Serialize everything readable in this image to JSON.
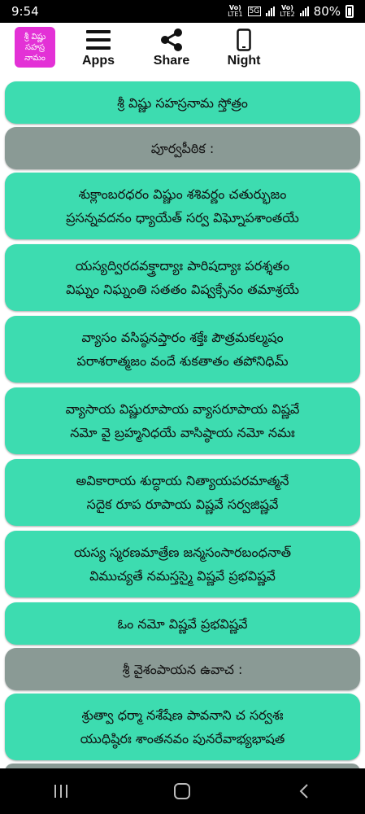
{
  "status": {
    "time": "9:54",
    "sim1_top": "Vo)",
    "sim1_bottom": "LTE1",
    "net_5g": "5G",
    "sim2_top": "Vo)",
    "sim2_bottom": "LTE2",
    "battery": "80%"
  },
  "header": {
    "logo_text": "శ్రీ విష్ణు సహస్ర నామం",
    "nav": [
      {
        "label": "Apps",
        "icon": "menu-icon"
      },
      {
        "label": "Share",
        "icon": "share-icon"
      },
      {
        "label": "Night",
        "icon": "phone-icon"
      }
    ]
  },
  "colors": {
    "verse_bg": "#3ddcb0",
    "heading_bg": "#8a9a95",
    "logo_bg": "#e331d6"
  },
  "items": [
    {
      "type": "verse",
      "lines": [
        "శ్రీ విష్ణు సహస్రనామ స్తోత్రం"
      ]
    },
    {
      "type": "heading",
      "lines": [
        "పూర్వపీఠిక :"
      ]
    },
    {
      "type": "verse",
      "lines": [
        "శుక్లాంబరధరం విష్ణుం శశివర్ణం చతుర్భుజం",
        "ప్రసన్నవదనం ధ్యాయేత్ సర్వ విఘ్నోపశాంతయే"
      ]
    },
    {
      "type": "verse",
      "lines": [
        "యస్యద్విరదవక్త్రాద్యాః పారిషద్యాః పరశ్శతం",
        "విఘ్నం నిఘ్నంతి సతతం విష్వక్సేనం తమాశ్రయే"
      ]
    },
    {
      "type": "verse",
      "lines": [
        "వ్యాసం వసిష్ఠనప్తారం శక్తేః పౌత్రమకల్మషం",
        "పరాశరాత్మజం వందే శుకతాతం తపోనిధిమ్"
      ]
    },
    {
      "type": "verse",
      "lines": [
        "వ్యాసాయ విష్ణురూపాయ వ్యాసరూపాయ విష్ణవే",
        "నమో వై బ్రహ్మనిధయే వాసిష్ఠాయ నమో నమః"
      ]
    },
    {
      "type": "verse",
      "lines": [
        "అవికారాయ శుద్ధాయ నిత్యాయపరమాత్మనే",
        "సదైక రూప రూపాయ విష్ణవే సర్వజిష్ణవే"
      ]
    },
    {
      "type": "verse",
      "lines": [
        "యస్య స్మరణమాత్రేణ జన్మసంసారబంధనాత్",
        "విముచ్యతే నమస్తస్మై విష్ణవే ప్రభవిష్ణవే"
      ]
    },
    {
      "type": "verse",
      "lines": [
        "ఓం నమో విష్ణవే ప్రభవిష్ణవే"
      ]
    },
    {
      "type": "heading",
      "lines": [
        "శ్రీ వైశంపాయన ఉవాచ :"
      ]
    },
    {
      "type": "verse",
      "lines": [
        "శ్రుత్వా ధర్మా నశేషేణ పావనాని చ సర్వశః",
        "యుధిష్ఠిరః శాంతనవం పునరేవాభ్యభాషత"
      ]
    },
    {
      "type": "heading",
      "lines": []
    }
  ]
}
